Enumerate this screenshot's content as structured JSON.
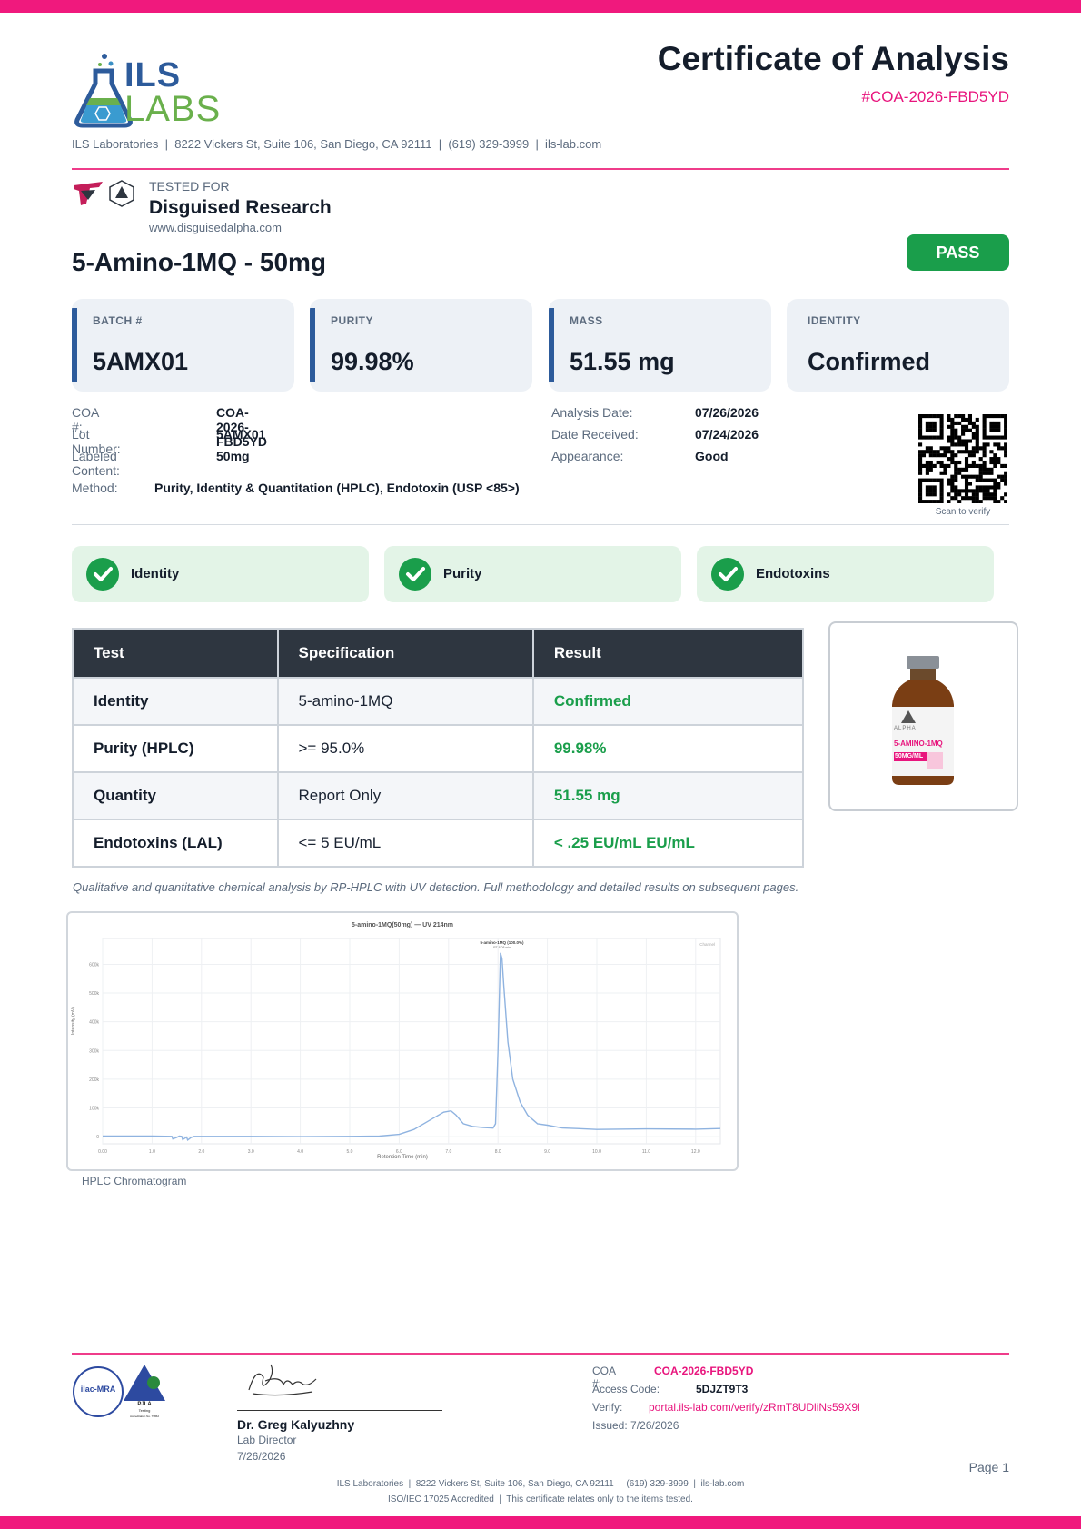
{
  "header": {
    "logo_top": "ILS",
    "logo_bottom": "LABS",
    "title": "Certificate of Analysis",
    "coa_id": "#COA-2026-FBD5YD",
    "lab_line": "ILS Laboratories  |  8222 Vickers St, Suite 106, San Diego, CA 92111  |  (619) 329-3999  |  ils-lab.com"
  },
  "client": {
    "tested_for_label": "TESTED FOR",
    "name": "Disguised Research",
    "website": "www.disguisedalpha.com"
  },
  "product": {
    "name": "5-Amino-1MQ - 50mg",
    "status": "PASS"
  },
  "stats": [
    {
      "label": "BATCH #",
      "value": "5AMX01"
    },
    {
      "label": "PURITY",
      "value": "99.98%"
    },
    {
      "label": "MASS",
      "value": "51.55 mg"
    },
    {
      "label": "IDENTITY",
      "value": "Confirmed"
    }
  ],
  "details_left": [
    {
      "key": "COA #:",
      "value": "COA-2026-FBD5YD"
    },
    {
      "key": "Lot Number:",
      "value": "5AMX01"
    },
    {
      "key": "Labeled Content:",
      "value": "50mg"
    }
  ],
  "details_right": [
    {
      "key": "Analysis Date:",
      "value": "07/26/2026"
    },
    {
      "key": "Date Received:",
      "value": "07/24/2026"
    },
    {
      "key": "Appearance:",
      "value": "Good"
    }
  ],
  "method": {
    "key": "Method:",
    "value": "Purity, Identity & Quantitation (HPLC), Endotoxin (USP <85>)"
  },
  "qr_caption": "Scan to verify",
  "checks": [
    "Identity",
    "Purity",
    "Endotoxins"
  ],
  "table": {
    "headers": [
      "Test",
      "Specification",
      "Result"
    ],
    "rows": [
      {
        "test": "Identity",
        "spec": "5-amino-1MQ",
        "result": "Confirmed"
      },
      {
        "test": "Purity (HPLC)",
        "spec": ">= 95.0%",
        "result": "99.98%"
      },
      {
        "test": "Quantity",
        "spec": "Report Only",
        "result": "51.55 mg"
      },
      {
        "test": "Endotoxins (LAL)",
        "spec": "<= 5 EU/mL",
        "result": "< .25 EU/mL EU/mL"
      }
    ]
  },
  "vial_label": {
    "brand": "ALPHA",
    "name": "5-AMINO-1MQ",
    "dose": "50MG/ML"
  },
  "analysis_note": "Qualitative and quantitative chemical analysis by RP-HPLC with UV detection. Full methodology and detailed results on subsequent pages.",
  "chart_data": {
    "type": "line",
    "title": "5-amino-1MQ(50mg) — UV 214nm",
    "xlabel": "Retention Time (min)",
    "ylabel": "Intensity (mV)",
    "xlim": [
      0,
      12.5
    ],
    "ylim": [
      -25,
      690
    ],
    "x_ticks": [
      "0.00",
      "1.0",
      "2.0",
      "3.0",
      "4.0",
      "5.0",
      "6.0",
      "7.0",
      "8.0",
      "9.0",
      "10.0",
      "11.0",
      "12.0"
    ],
    "y_ticks": [
      "0",
      "100k",
      "200k",
      "300k",
      "400k",
      "500k",
      "600k"
    ],
    "grid": true,
    "peak_label": "5-amino-1MQ (100.0%)",
    "peak_sublabel": "RT 8.08 min",
    "legend_label": "Channel",
    "series": [
      {
        "x": [
          0,
          1.0,
          1.4,
          1.42,
          1.5,
          1.55,
          1.6,
          1.62,
          1.7,
          1.72,
          1.78,
          1.85,
          2.0,
          3.0,
          4.0,
          5.0,
          5.6,
          6.0,
          6.3,
          6.6,
          6.9,
          7.05,
          7.15,
          7.3,
          7.5,
          7.7,
          7.9,
          7.95,
          8.0,
          8.05,
          8.08,
          8.12,
          8.2,
          8.3,
          8.45,
          8.6,
          8.8,
          9.0,
          9.3,
          9.6,
          10.0,
          11.0,
          12.0,
          12.5
        ],
        "y": [
          2,
          2,
          1,
          -8,
          -3,
          2,
          1,
          -10,
          -2,
          -12,
          -4,
          1,
          1,
          1,
          0,
          1,
          2,
          8,
          25,
          55,
          85,
          90,
          75,
          45,
          35,
          32,
          30,
          45,
          300,
          640,
          620,
          520,
          330,
          200,
          120,
          75,
          45,
          40,
          30,
          28,
          25,
          27,
          26,
          28
        ]
      }
    ]
  },
  "chart_caption": "HPLC Chromatogram",
  "footer": {
    "seal_ilac": "ilac-MRA",
    "seal_pjla_title": "PJLA",
    "seal_pjla_sub": "Testing",
    "seal_pjla_acc": "Accreditation No. 79862",
    "signer_name": "Dr. Greg Kalyuzhny",
    "signer_title": "Lab Director",
    "sign_date": "7/26/2026",
    "coa_label": "COA #:",
    "coa_value": "COA-2026-FBD5YD",
    "access_label": "Access Code:",
    "access_value": "5DJZT9T3",
    "verify_label": "Verify:",
    "verify_value": "portal.ils-lab.com/verify/zRmT8UDliNs59X9l",
    "issued": "Issued: 7/26/2026",
    "page": "Page 1",
    "bottom_line1": "ILS Laboratories  |  8222 Vickers St, Suite 106, San Diego, CA 92111  |  (619) 329-3999  |  ils-lab.com",
    "bottom_line2": "ISO/IEC 17025 Accredited  |  This certificate relates only to the items tested."
  }
}
